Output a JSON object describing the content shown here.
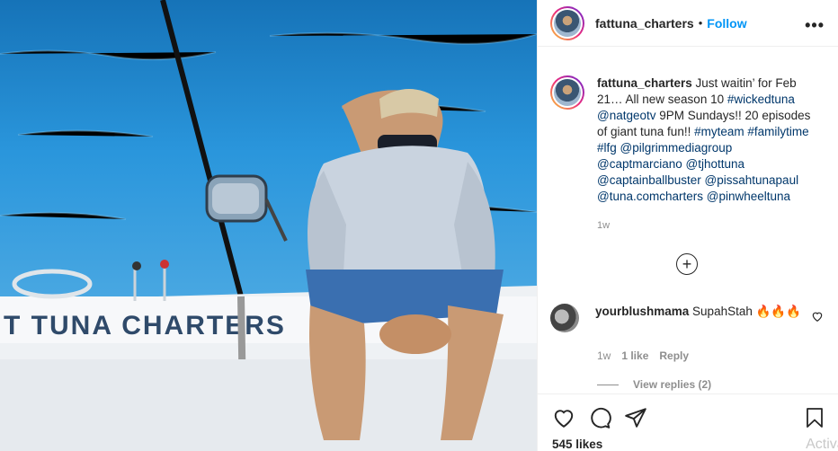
{
  "post": {
    "username": "fattuna_charters",
    "separator": "•",
    "follow_label": "Follow",
    "more_icon": "more-options-icon",
    "more_glyph": "•••"
  },
  "photo": {
    "boat_text": "T TUNA CHARTERS",
    "colors": {
      "sea": "#1e8fd6",
      "shirt": "#c9d3df",
      "shorts": "#3a6fb0",
      "boat": "#f4f6f8",
      "lettering": "#2f4a6a"
    }
  },
  "caption": {
    "username": "fattuna_charters",
    "text_1": " Just waitin’ for Feb 21… All new season 10 ",
    "tag_1": "#wickedtuna",
    "tag_2": "@natgeotv",
    "text_2": " 9PM Sundays!! 20 episodes of giant tuna fun!! ",
    "tag_3": "#myteam",
    "tag_4": "#familytime",
    "tag_5": "#lfg",
    "tag_6": "@pilgrimmediagroup",
    "tag_7": "@captmarciano",
    "tag_8": "@tjhottuna",
    "tag_9": "@captainballbuster",
    "tag_10": "@pissahtunapaul",
    "tag_11": "@tuna.comcharters",
    "tag_12": "@pinwheeltuna",
    "time": "1w"
  },
  "load_more_glyph": "+",
  "comment": {
    "username": "yourblushmama",
    "text": "SupahStah 🔥🔥🔥",
    "time": "1w",
    "likes": "1 like",
    "reply": "Reply",
    "view_replies": "View replies (2)"
  },
  "footer": {
    "likes": "545 likes",
    "watermark": "Activate"
  }
}
